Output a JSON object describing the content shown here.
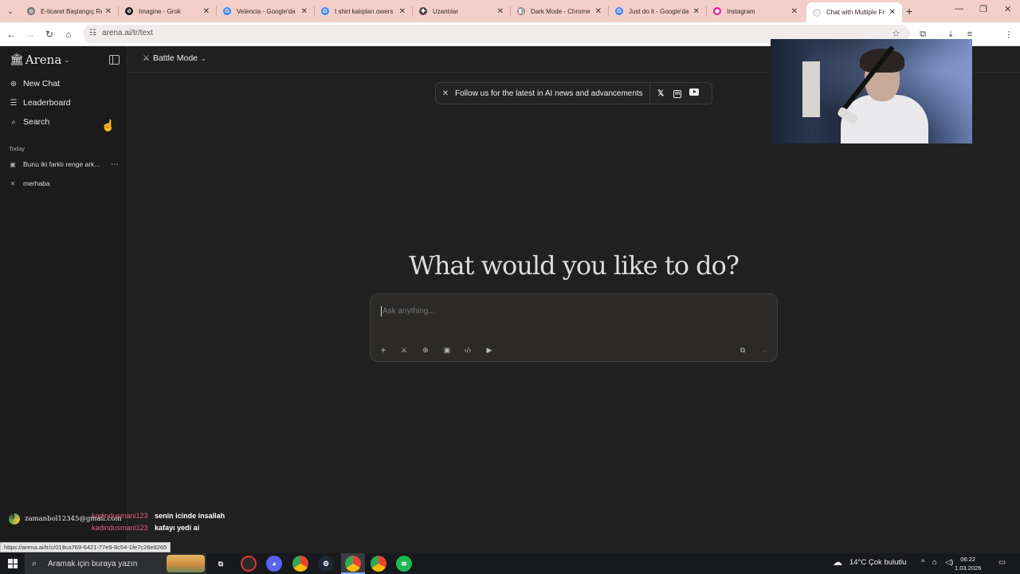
{
  "browser": {
    "tabs": [
      {
        "title": "E-ticaret Başlangıç Re",
        "favicon": "globe",
        "color": "#6b6b6b"
      },
      {
        "title": "Imagine - Grok",
        "favicon": "grok",
        "color": "#111111"
      },
      {
        "title": "Velencia - Google'da",
        "favicon": "google",
        "color": "#4285f4"
      },
      {
        "title": "t shirt kalıpları owers",
        "favicon": "google",
        "color": "#4285f4"
      },
      {
        "title": "Uzantılar",
        "favicon": "puzzle",
        "color": "#444444"
      },
      {
        "title": "Dark Mode - Chrome",
        "favicon": "webstore",
        "color": "#888888"
      },
      {
        "title": "Just do it - Google'da",
        "favicon": "google",
        "color": "#4285f4"
      },
      {
        "title": "Instagram",
        "favicon": "instagram",
        "color": "#d6249f"
      },
      {
        "title": "Chat with Multiple Fr",
        "favicon": "arena",
        "color": "#ffffff"
      }
    ],
    "url": "arena.ai/tr/text",
    "status_url": "https://arena.ai/tr/c/019ca769-6421-77e9-8c54-1fe7c28e8265"
  },
  "sidebar": {
    "brand": "Arena",
    "nav": [
      {
        "label": "New Chat",
        "icon": "plus-circle-icon"
      },
      {
        "label": "Leaderboard",
        "icon": "list-icon"
      },
      {
        "label": "Search",
        "icon": "search-icon"
      }
    ],
    "section_label": "Today",
    "history": [
      {
        "label": "Bunu iki farklı renge ark...",
        "icon": "image-icon"
      },
      {
        "label": "merhaba",
        "icon": "swords-icon"
      }
    ]
  },
  "header": {
    "mode": "Battle Mode"
  },
  "banner": {
    "text": "Follow us for the latest in AI news and advancements",
    "socials": [
      "X",
      "LinkedIn",
      "YouTube"
    ]
  },
  "main": {
    "hero": "What would you like to do?",
    "placeholder": "Ask anything..."
  },
  "overlay": {
    "user_email": "zamanbol12345@gmail.com",
    "chat": [
      {
        "user": "kadindusmani123",
        "message": "senin icinde insallah"
      },
      {
        "user": "kadindusmani123",
        "message": "kafayı yedi ai"
      }
    ]
  },
  "taskbar": {
    "search_placeholder": "Aramak için buraya yazın",
    "weather": "14°C  Çok bulutlu",
    "time": "06:22",
    "date": "1.03.2026"
  },
  "colors": {
    "tabstrip": "#f2cfc8",
    "app_bg": "#202020",
    "chat_user": "#e0607e"
  }
}
